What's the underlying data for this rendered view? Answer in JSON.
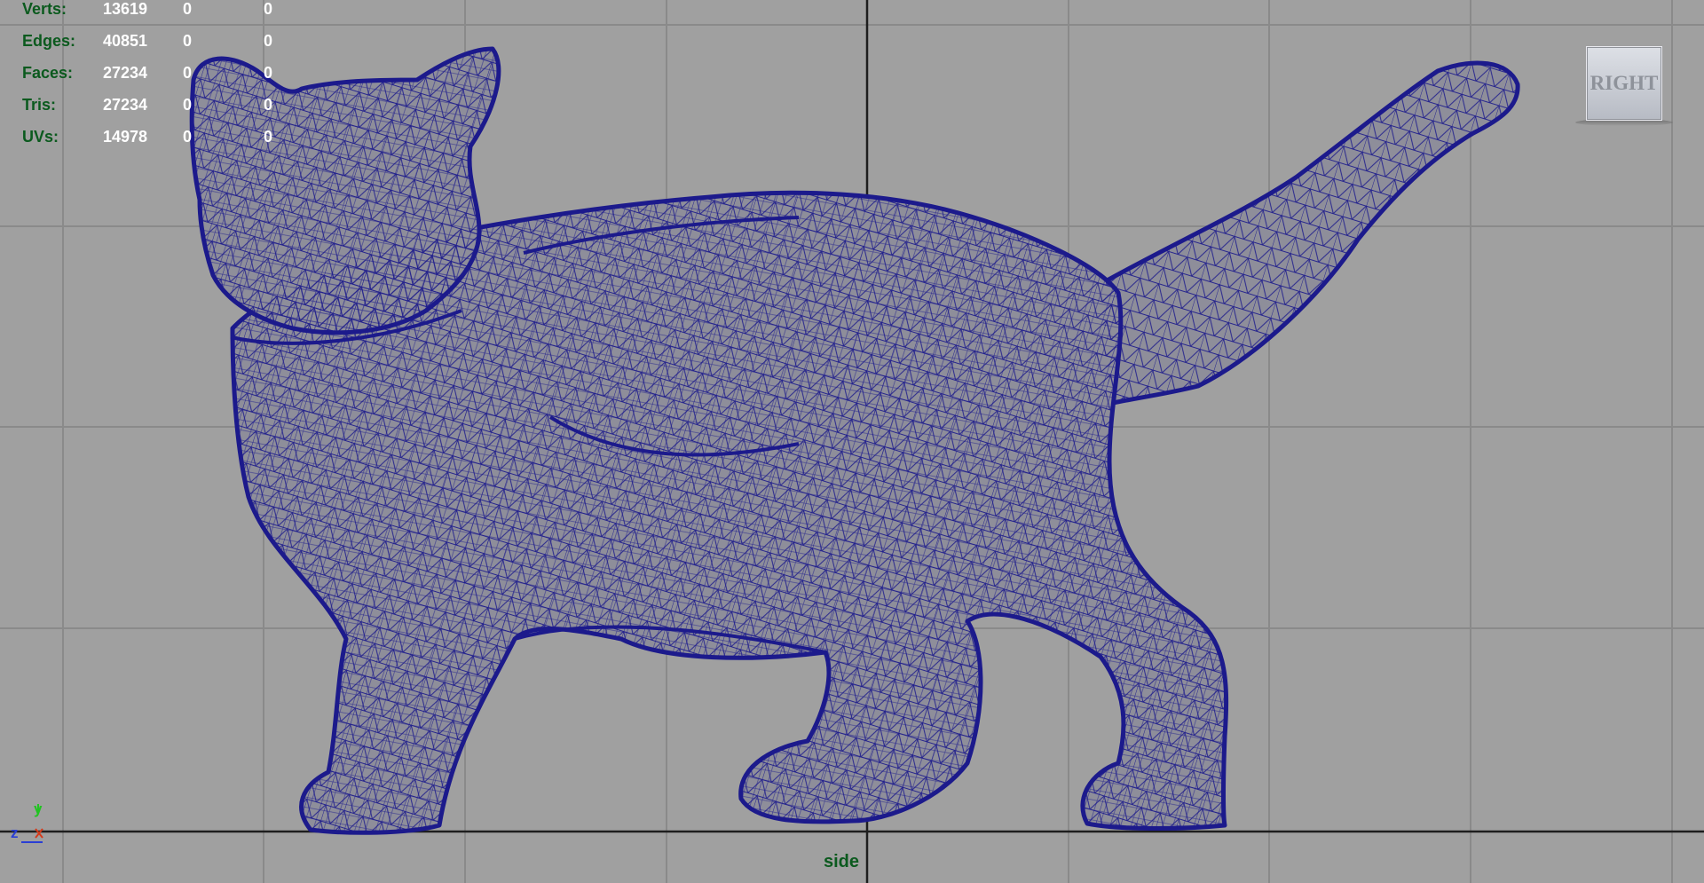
{
  "hud": {
    "rows": [
      {
        "label": "Verts:",
        "v1": "13619",
        "v2": "0",
        "v3": "0"
      },
      {
        "label": "Edges:",
        "v1": "40851",
        "v2": "0",
        "v3": "0"
      },
      {
        "label": "Faces:",
        "v1": "27234",
        "v2": "0",
        "v3": "0"
      },
      {
        "label": "Tris:",
        "v1": "27234",
        "v2": "0",
        "v3": "0"
      },
      {
        "label": "UVs:",
        "v1": "14978",
        "v2": "0",
        "v3": "0"
      }
    ]
  },
  "view_cube": {
    "label": "RIGHT"
  },
  "camera": {
    "name": "side"
  },
  "axis_gizmo": {
    "y": "y",
    "z": "z",
    "x": "x"
  },
  "colors": {
    "background": "#a0a0a0",
    "grid": "#8c8c8c",
    "grid_axis": "#1e1e1e",
    "wireframe": "#1c1a8c",
    "hud_label": "#0b5a1e",
    "hud_value": "#ffffff"
  }
}
